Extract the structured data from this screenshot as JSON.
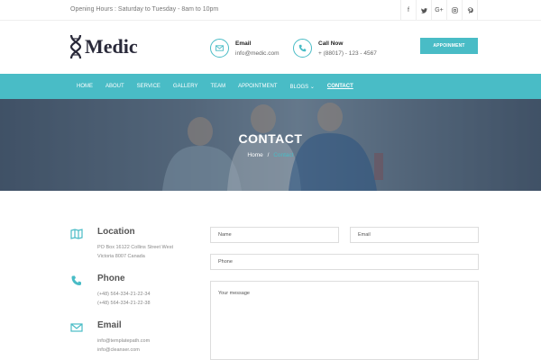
{
  "topbar": {
    "hours": "Opening Hours : Saturday to Tuesday - 8am to 10pm",
    "socials": [
      {
        "icon": "facebook-icon",
        "glyph": "f"
      },
      {
        "icon": "twitter-icon",
        "glyph": "🐦"
      },
      {
        "icon": "google-plus-icon",
        "glyph": "G+"
      },
      {
        "icon": "instagram-icon",
        "glyph": "◎"
      },
      {
        "icon": "pinterest-icon",
        "glyph": "P"
      }
    ]
  },
  "header": {
    "brand": "Medic",
    "email_title": "Email",
    "email_value": "info@medic.com",
    "call_title": "Call Now",
    "call_value": "+ (88017) - 123 - 4567",
    "appointment_button": "APPOINMENT"
  },
  "nav": {
    "items": [
      "HOME",
      "ABOUT",
      "SERVICE",
      "GALLERY",
      "TEAM",
      "APPOINTMENT",
      "BLOGS ⌄",
      "CONTACT"
    ],
    "active": "CONTACT"
  },
  "banner": {
    "title": "CONTACT",
    "crumb_home": "Home",
    "crumb_sep": "/",
    "crumb_current": "Contact"
  },
  "info": {
    "location": {
      "title": "Location",
      "lines": [
        "PO Box 16122 Collins Street West",
        "Victoria 8007 Canada"
      ]
    },
    "phone": {
      "title": "Phone",
      "lines": [
        "(+48) 564-334-21-22-34",
        "(+48) 564-334-21-22-38"
      ]
    },
    "email": {
      "title": "Email",
      "lines": [
        "info@templatepath.com",
        "info@cleanser.com"
      ]
    }
  },
  "form": {
    "name_placeholder": "Name",
    "email_placeholder": "Email",
    "phone_placeholder": "Phone",
    "message_placeholder": "Your message"
  },
  "colors": {
    "accent": "#49bcc6",
    "dark": "#2a2a3a"
  }
}
